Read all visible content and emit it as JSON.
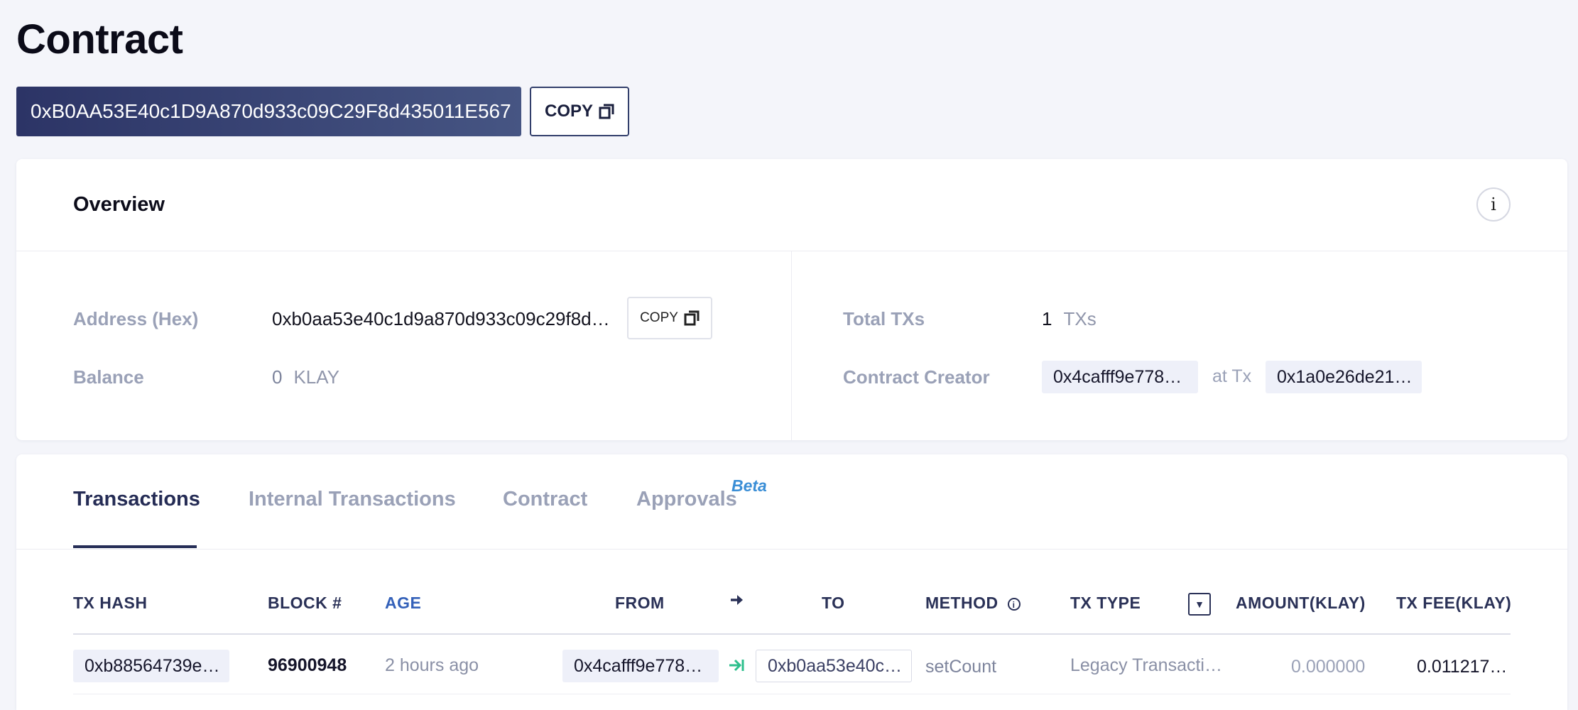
{
  "page": {
    "title": "Contract",
    "address": "0xB0AA53E40c1D9A870d933c09C29F8d435011E567",
    "copy_label": "COPY"
  },
  "overview": {
    "title": "Overview",
    "info_label": "i",
    "address_hex_label": "Address (Hex)",
    "address_hex_value": "0xb0aa53e40c1d9a870d933c09c29f8d…",
    "copy_label": "COPY",
    "balance_label": "Balance",
    "balance_value": "0",
    "balance_unit": "KLAY",
    "total_txs_label": "Total TXs",
    "total_txs_value": "1",
    "total_txs_unit": "TXs",
    "creator_label": "Contract Creator",
    "creator_value": "0x4cafff9e778…",
    "at_tx_label": "at Tx",
    "creator_tx_value": "0x1a0e26de21…"
  },
  "tabs": [
    {
      "label": "Transactions",
      "active": true
    },
    {
      "label": "Internal Transactions",
      "active": false
    },
    {
      "label": "Contract",
      "active": false
    },
    {
      "label": "Approvals",
      "active": false,
      "badge": "Beta"
    }
  ],
  "table": {
    "columns": [
      "TX HASH",
      "BLOCK #",
      "AGE",
      "FROM",
      "TO",
      "METHOD",
      "TX TYPE",
      "AMOUNT(KLAY)",
      "TX FEE(KLAY)"
    ],
    "rows": [
      {
        "tx_hash": "0xb88564739e…",
        "block": "96900948",
        "age": "2 hours ago",
        "from": "0x4cafff9e778…",
        "to": "0xb0aa53e40c…",
        "method": "setCount",
        "tx_type": "Legacy Transacti…",
        "amount": "0.000000",
        "fee": "0.011217…"
      }
    ]
  },
  "colors": {
    "accent_dark": "#262e57",
    "pill_start": "#2c3466",
    "pill_end": "#465583",
    "beta": "#3a8ed6",
    "age_header": "#3461b9",
    "arrow_green": "#2dbf8c"
  }
}
